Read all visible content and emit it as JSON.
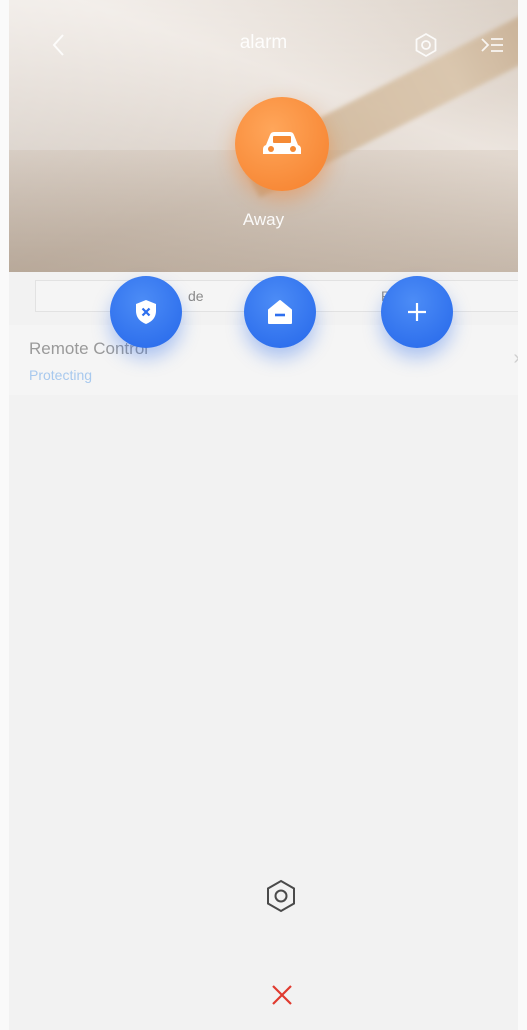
{
  "nav": {
    "back_icon": "chevron-left-icon",
    "title": "alarm",
    "settings_icon": "hexagon-gear-icon",
    "menu_icon": "list-menu-icon"
  },
  "mode": {
    "icon": "car-icon",
    "label": "Away",
    "color": "#f57f2b"
  },
  "tabs": [
    {
      "label": "de"
    },
    {
      "label": "Pict"
    }
  ],
  "actions": [
    {
      "icon": "shield-x-icon"
    },
    {
      "icon": "home-minus-icon"
    },
    {
      "icon": "plus-icon"
    }
  ],
  "accent_color": "#2567ea",
  "list": {
    "items": [
      {
        "name": "Remote Control",
        "status": "Protecting",
        "chevron": "›"
      }
    ]
  },
  "bottom": {
    "settings_icon": "hexagon-gear-icon",
    "close_icon": "close-x-icon",
    "close_color": "#e03a2f"
  }
}
